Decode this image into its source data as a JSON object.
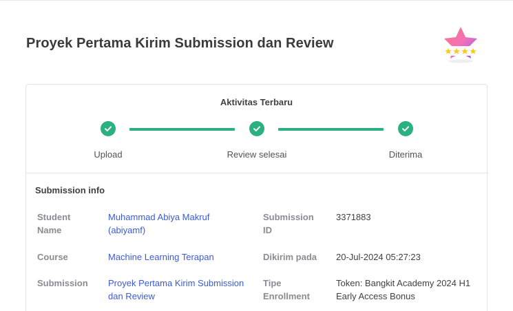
{
  "page": {
    "title": "Proyek Pertama Kirim Submission dan Review"
  },
  "badge": {
    "icon": "star-badge-icon",
    "stars": 4,
    "colors": {
      "gradient_start": "#f472b6",
      "gradient_end": "#a855f7",
      "star": "#facc15"
    }
  },
  "activity": {
    "title": "Aktivitas Terbaru",
    "accent_color": "#2bb07f",
    "steps": [
      {
        "label": "Upload",
        "icon": "check-icon"
      },
      {
        "label": "Review selesai",
        "icon": "check-icon"
      },
      {
        "label": "Diterima",
        "icon": "check-icon"
      }
    ]
  },
  "submission_info": {
    "title": "Submission info",
    "student_name": {
      "label_line1": "Student",
      "label_line2": "Name",
      "value_line1": "Muhammad Abiya Makruf",
      "value_line2": "(abiyamf)"
    },
    "submission_id": {
      "label_line1": "Submission",
      "label_line2": "ID",
      "value": "3371883"
    },
    "course": {
      "label": "Course",
      "value": "Machine Learning Terapan"
    },
    "dikirim_pada": {
      "label": "Dikirim pada",
      "value": "20-Jul-2024 05:27:23"
    },
    "submission": {
      "label": "Submission",
      "value_line1": "Proyek Pertama Kirim Submission",
      "value_line2": "dan Review"
    },
    "tipe_enrollment": {
      "label_line1": "Tipe",
      "label_line2": "Enrollment",
      "value_line1": "Token: Bangkit Academy 2024 H1",
      "value_line2": "Early Access Bonus"
    }
  }
}
